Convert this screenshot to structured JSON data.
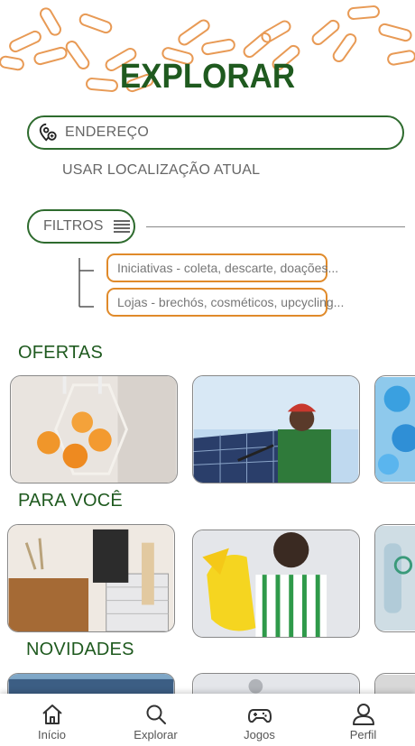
{
  "header": {
    "title": "EXPLORAR"
  },
  "search": {
    "placeholder": "ENDEREÇO",
    "use_location": "USAR LOCALIZAÇÃO ATUAL"
  },
  "filters": {
    "label": "FILTROS",
    "options": [
      "Iniciativas - coleta, descarte, doações...",
      "Lojas - brechós, cosméticos, upcycling..."
    ]
  },
  "sections": {
    "ofertas": "OFERTAS",
    "para_voce": "PARA VOCÊ",
    "novidades": "NOVIDADES"
  },
  "colors": {
    "primary_green": "#1f5a1f",
    "accent_orange": "#e08a2a"
  },
  "nav": {
    "items": [
      {
        "label": "Início",
        "icon": "home-icon"
      },
      {
        "label": "Explorar",
        "icon": "search-icon"
      },
      {
        "label": "Jogos",
        "icon": "gamepad-icon"
      },
      {
        "label": "Perfil",
        "icon": "user-icon"
      }
    ]
  }
}
